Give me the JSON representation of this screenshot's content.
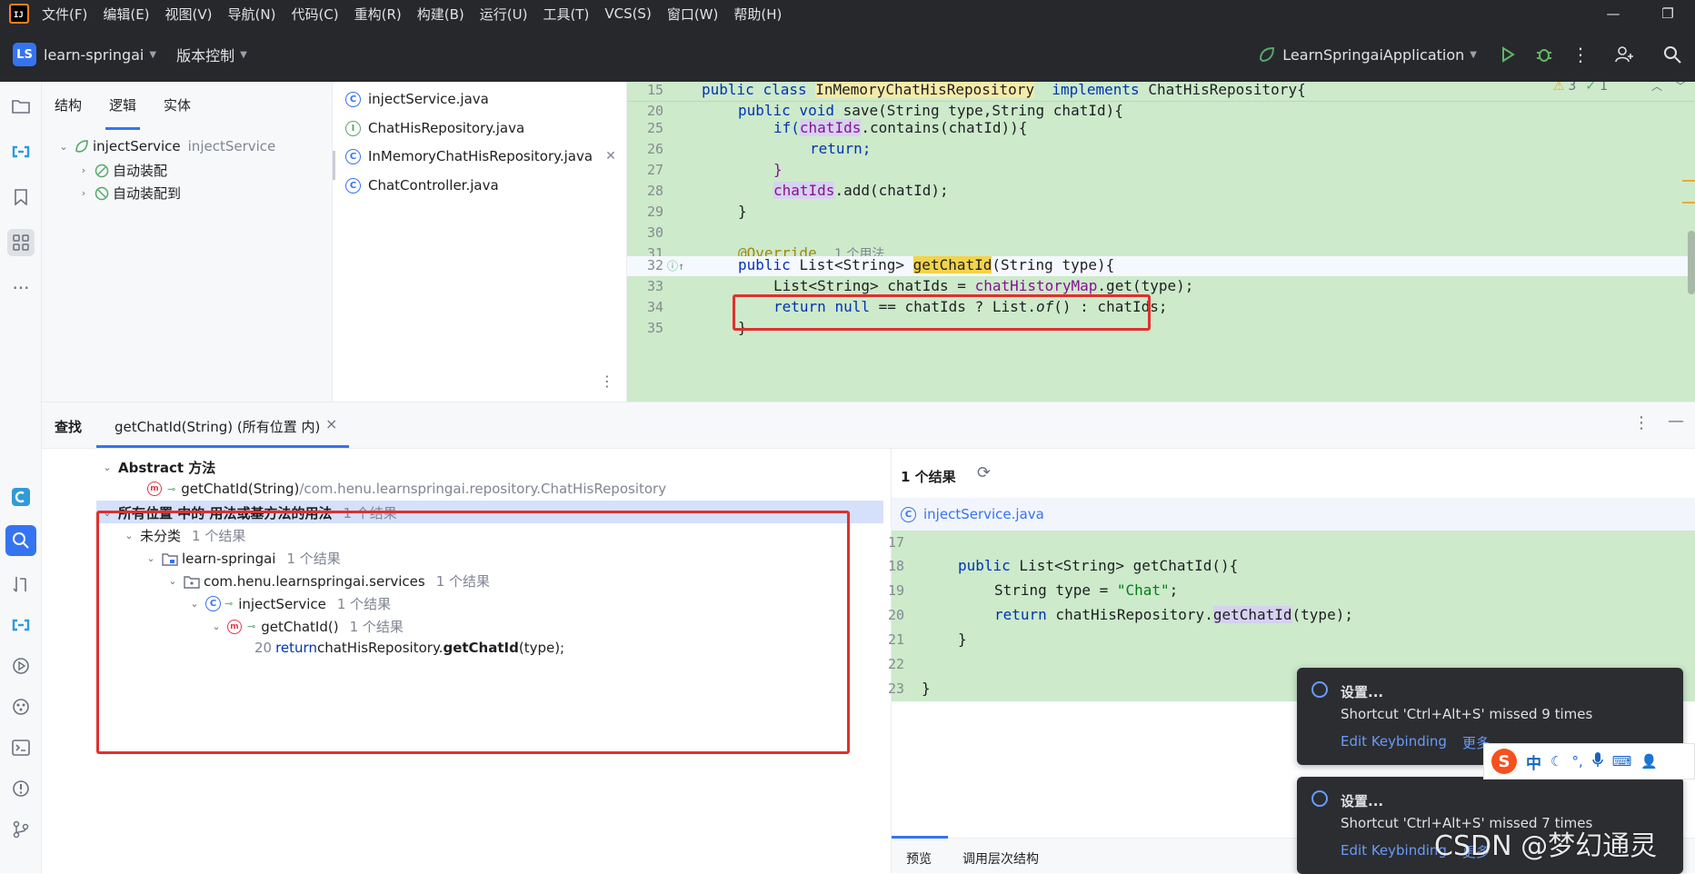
{
  "menubar": {
    "items": [
      "文件(F)",
      "编辑(E)",
      "视图(V)",
      "导航(N)",
      "代码(C)",
      "重构(R)",
      "构建(B)",
      "运行(U)",
      "工具(T)",
      "VCS(S)",
      "窗口(W)",
      "帮助(H)"
    ],
    "minimize": "—",
    "restore": "❐"
  },
  "toolbar": {
    "project_badge": "LS",
    "project_name": "learn-springai",
    "vcs_label": "版本控制",
    "run_config": "LearnSpringaiApplication"
  },
  "structure": {
    "tabs": [
      "结构",
      "逻辑",
      "实体"
    ],
    "root": {
      "name": "injectService",
      "hint": "injectService"
    },
    "children": [
      "自动装配",
      "自动装配到"
    ]
  },
  "files": [
    "injectService.java",
    "ChatHisRepository.java",
    "InMemoryChatHisRepository.java",
    "ChatController.java"
  ],
  "editor": {
    "warnings": "3",
    "checks": "1",
    "lines": {
      "l15": "15",
      "l20": "20",
      "l25": "25",
      "l26": "26",
      "l27": "27",
      "l28": "28",
      "l29": "29",
      "l30": "30",
      "l31": "31",
      "l32": "32",
      "l33": "33",
      "l34": "34",
      "l35": "35"
    },
    "code": {
      "public": "public",
      "class": "class",
      "class_name": "InMemoryChatHisRepository",
      "implements": "implements",
      "iface": "ChatHisRepository{",
      "save_sig": "save(String type,String chatId){",
      "public_void": "public void",
      "if": "if(",
      "chatIds": "chatIds",
      "contains": ".contains(chatId)){",
      "return": "return;",
      "close_brace": "}",
      "add": ".add(chatId);",
      "override": "@Override",
      "usage": "1 个用法",
      "list_string": "List<String>",
      "getChatId": "getChatId",
      "param": "(String type){",
      "list_decl": "List<String> chatIds = ",
      "history_map": "chatHistoryMap",
      "get_type": ".get(type);",
      "return_kw": "return",
      "null": "null",
      "ternary": " == chatIds ? List.",
      "of": "of",
      "tail": "() : chatIds;"
    }
  },
  "find": {
    "tab_find": "查找",
    "tab_query": "getChatId(String) (所有位置 内)",
    "close": "×",
    "abstract_group": "Abstract 方法",
    "abstract_method": "getChatId(String)",
    "abstract_path": "/com.henu.learnspringai.repository.ChatHisRepository",
    "usages_group": "所有位置 中的 用法或基方法的用法",
    "usages_count": "1 个结果",
    "uncategorized": "未分类",
    "uncategorized_count": "1 个结果",
    "module": "learn-springai",
    "module_count": "1 个结果",
    "package": "com.henu.learnspringai.services",
    "package_count": "1 个结果",
    "class": "injectService",
    "class_count": "1 个结果",
    "method": "getChatId()",
    "method_count": "1 个结果",
    "result_line": "20",
    "result_prefix": "return",
    "result_mid": " chatHisRepository.",
    "result_bold": "getChatId",
    "result_tail": "(type);"
  },
  "preview": {
    "results": "1 个结果",
    "file": "injectService.java",
    "lines": {
      "l17": "17",
      "l18": "18",
      "l19": "19",
      "l20": "20",
      "l21": "21",
      "l22": "22",
      "l23": "23"
    },
    "code": {
      "public": "public",
      "sig": " List<String> getChatId(){",
      "string_type": "String type = ",
      "chat": "\"Chat\"",
      "semi": ";",
      "return": "return",
      "call": " chatHisRepository.",
      "getChatId": "getChatId",
      "arg": "(type);",
      "brace1": "}",
      "brace2": "}"
    },
    "tab_preview": "预览",
    "tab_hierarchy": "调用层次结构"
  },
  "notifications": [
    {
      "title": "设置...",
      "body": "Shortcut 'Ctrl+Alt+S' missed 9 times",
      "link": "Edit Keybinding",
      "more": "更多 ⌄"
    },
    {
      "title": "设置...",
      "body": "Shortcut 'Ctrl+Alt+S' missed 7 times",
      "link": "Edit Keybinding",
      "more": "更多"
    }
  ],
  "ime": {
    "logo": "S",
    "mode": "中"
  },
  "watermark": "CSDN @梦幻通灵",
  "colors": {
    "accent": "#3574f0",
    "editor_bg": "#cdeacb",
    "highlight": "#e0302f"
  }
}
